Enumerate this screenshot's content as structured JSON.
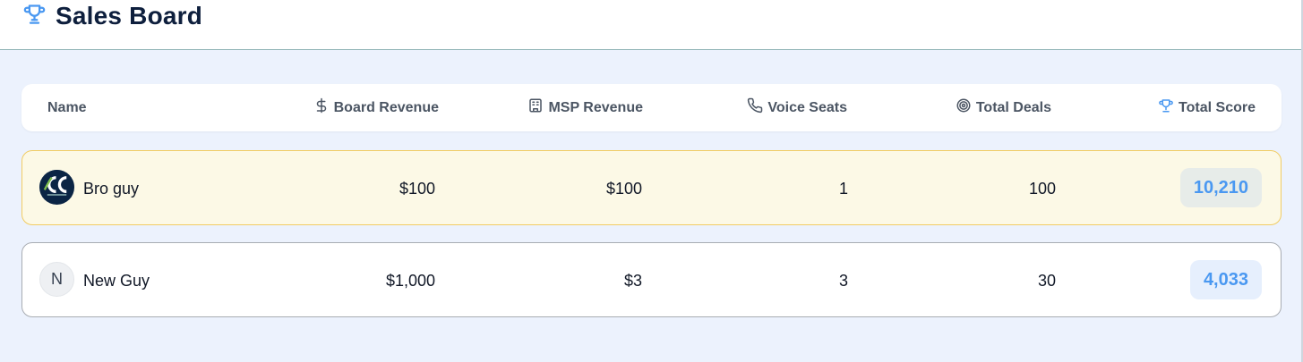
{
  "header": {
    "icon": "trophy-icon",
    "title": "Sales Board",
    "accent": "#4a98f1",
    "title_color": "#0e1f3d"
  },
  "columns": {
    "name": "Name",
    "board_revenue": {
      "label": "Board Revenue",
      "icon": "dollar-icon"
    },
    "msp_revenue": {
      "label": "MSP Revenue",
      "icon": "building-icon"
    },
    "voice_seats": {
      "label": "Voice Seats",
      "icon": "phone-icon"
    },
    "total_deals": {
      "label": "Total Deals",
      "icon": "target-icon"
    },
    "total_score": {
      "label": "Total Score",
      "icon": "trophy-icon"
    }
  },
  "rows": [
    {
      "avatar": {
        "type": "logo",
        "icon": "company-logo-icon"
      },
      "name": "Bro guy",
      "board_revenue": "$100",
      "msp_revenue": "$100",
      "voice_seats": "1",
      "total_deals": "100",
      "total_score": "10,210",
      "highlight_color": "#f1cc63"
    },
    {
      "avatar": {
        "type": "initial",
        "initial": "N"
      },
      "name": "New Guy",
      "board_revenue": "$1,000",
      "msp_revenue": "$3",
      "voice_seats": "3",
      "total_deals": "30",
      "total_score": "4,033"
    }
  ]
}
